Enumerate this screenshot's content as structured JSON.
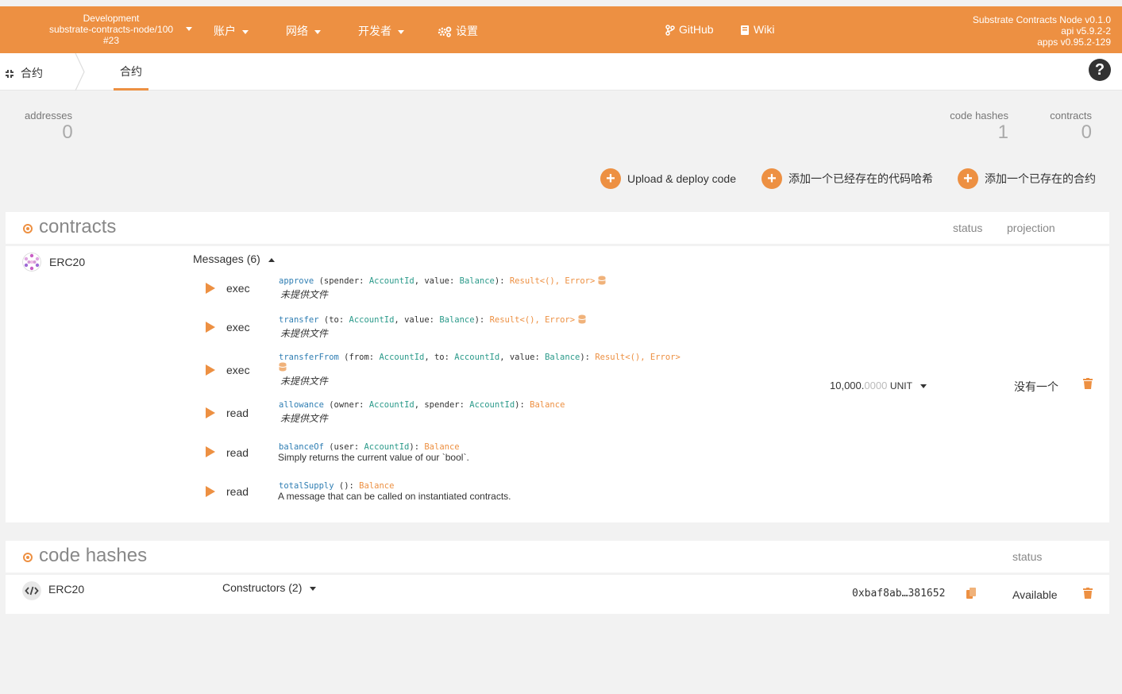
{
  "header": {
    "chain": {
      "line1": "Development",
      "line2": "substrate-contracts-node/100",
      "line3": "#23"
    },
    "nav": [
      {
        "label": "账户",
        "icon": ""
      },
      {
        "label": "网络",
        "icon": ""
      },
      {
        "label": "开发者",
        "icon": ""
      },
      {
        "label": "设置",
        "icon": "gears-icon"
      },
      {
        "label": "GitHub",
        "icon": "code-branch-icon"
      },
      {
        "label": "Wiki",
        "icon": "book-icon"
      }
    ],
    "version": {
      "line1": "Substrate Contracts Node v0.1.0",
      "line2": "api v5.9.2-2",
      "line3": "apps v0.95.2-129"
    },
    "accent": "#ed9042"
  },
  "subnav": {
    "section": "合约",
    "tab": "合约",
    "help": "?"
  },
  "summary": {
    "addresses": {
      "label": "addresses",
      "value": "0"
    },
    "code_hashes": {
      "label": "code hashes",
      "value": "1"
    },
    "contracts": {
      "label": "contracts",
      "value": "0"
    }
  },
  "actions": {
    "upload": "Upload & deploy code",
    "add_code_hash": "添加一个已经存在的代码哈希",
    "add_contract": "添加一个已存在的合约"
  },
  "contracts_panel": {
    "title": "contracts",
    "col_status": "status",
    "col_projection": "projection",
    "contract": {
      "name": "ERC20",
      "messages_label": "Messages (6)",
      "balance_int": "10,000.",
      "balance_dec": "0000",
      "balance_unit": "UNIT",
      "projection": "没有一个",
      "messages": [
        {
          "kind": "exec",
          "fn": "approve",
          "sig_open": " (spender: ",
          "t1": "AccountId",
          "sep1": ", value: ",
          "t2": "Balance",
          "close": "): ",
          "ret": "Result<(), Error>",
          "doc": "未提供文件"
        },
        {
          "kind": "exec",
          "fn": "transfer",
          "sig_open": " (to: ",
          "t1": "AccountId",
          "sep1": ", value: ",
          "t2": "Balance",
          "close": "): ",
          "ret": "Result<(), Error>",
          "doc": "未提供文件"
        },
        {
          "kind": "exec",
          "fn": "transferFrom",
          "sig_open": " (from: ",
          "t1": "AccountId",
          "sep1": ", to: ",
          "t2": "AccountId",
          "sep2": ", value: ",
          "t3": "Balance",
          "close": "): ",
          "ret": "Result<(), Error>",
          "doc": "未提供文件"
        },
        {
          "kind": "read",
          "fn": "allowance",
          "sig_open": " (owner: ",
          "t1": "AccountId",
          "sep1": ", spender: ",
          "t2": "AccountId",
          "close": "): ",
          "ret": "Balance",
          "doc": "未提供文件"
        },
        {
          "kind": "read",
          "fn": "balanceOf",
          "sig_open": " (user: ",
          "t1": "AccountId",
          "close": "): ",
          "ret": "Balance",
          "doc": "Simply returns the current value of our `bool`."
        },
        {
          "kind": "read",
          "fn": "totalSupply",
          "sig_open": " (",
          "close": "): ",
          "ret": "Balance",
          "doc": "A message that can be called on instantiated contracts."
        }
      ]
    }
  },
  "codehash_panel": {
    "title": "code hashes",
    "col_status": "status",
    "code": {
      "name": "ERC20",
      "constructors_label": "Constructors (2)",
      "hash": "0xbaf8ab…381652",
      "status": "Available"
    }
  }
}
